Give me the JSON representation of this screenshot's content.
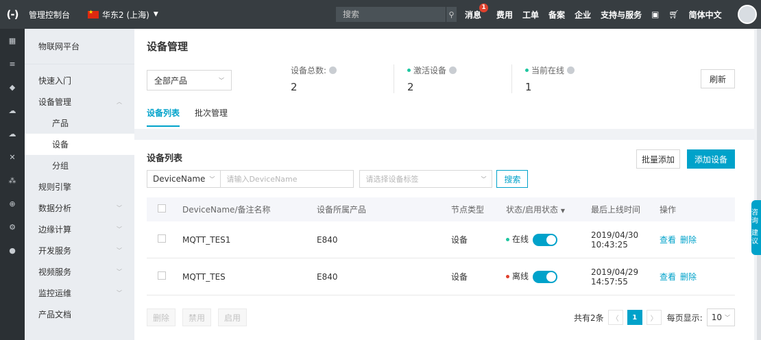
{
  "topbar": {
    "logo": "(-)",
    "console_label": "管理控制台",
    "region": "华东2 (上海)",
    "search_placeholder": "搜索",
    "menu": [
      {
        "label": "消息",
        "badge": "1"
      },
      {
        "label": "费用"
      },
      {
        "label": "工单"
      },
      {
        "label": "备案"
      },
      {
        "label": "企业"
      },
      {
        "label": "支持与服务"
      }
    ],
    "language": "简体中文"
  },
  "sidebar": {
    "title": "物联网平台",
    "items": [
      {
        "label": "快速入门",
        "sub": false
      },
      {
        "label": "设备管理",
        "sub": false
      },
      {
        "label": "产品",
        "sub": true
      },
      {
        "label": "设备",
        "sub": true
      },
      {
        "label": "分组",
        "sub": true
      },
      {
        "label": "规则引擎",
        "sub": false
      },
      {
        "label": "数据分析",
        "sub": false
      },
      {
        "label": "边缘计算",
        "sub": false
      },
      {
        "label": "开发服务",
        "sub": false
      },
      {
        "label": "视频服务",
        "sub": false
      },
      {
        "label": "监控运维",
        "sub": false
      },
      {
        "label": "产品文档",
        "sub": false
      }
    ]
  },
  "header": {
    "title": "设备管理",
    "product_select": "全部产品",
    "stats": [
      {
        "label": "设备总数:",
        "value": "2"
      },
      {
        "label": "激活设备",
        "value": "2"
      },
      {
        "label": "当前在线",
        "value": "1"
      }
    ],
    "refresh": "刷新",
    "tabs": [
      "设备列表",
      "批次管理"
    ]
  },
  "list": {
    "title": "设备列表",
    "batch_add": "批量添加",
    "add_device": "添加设备",
    "filter_field": "DeviceName",
    "filter_placeholder": "请输入DeviceName",
    "tag_placeholder": "请选择设备标签",
    "search_btn": "搜索",
    "columns": [
      "DeviceName/备注名称",
      "设备所属产品",
      "节点类型",
      "状态/启用状态",
      "最后上线时间",
      "操作"
    ],
    "rows": [
      {
        "name": "MQTT_TES1",
        "product": "E840",
        "node": "设备",
        "status": "在线",
        "status_color": "#1ec6a0",
        "date": "2019/04/30",
        "time": "10:43:25",
        "op1": "查看",
        "op2": "删除"
      },
      {
        "name": "MQTT_TES",
        "product": "E840",
        "node": "设备",
        "status": "离线",
        "status_color": "#e0412d",
        "date": "2019/04/29",
        "time": "14:57:55",
        "op1": "查看",
        "op2": "删除"
      }
    ],
    "bottom_buttons": [
      "删除",
      "禁用",
      "启用"
    ],
    "total_text": "共有2条",
    "page": "1",
    "page_size_label": "每页显示:",
    "page_size": "10"
  },
  "float": {
    "text1": "咨询",
    "text2": "建议"
  },
  "colors": {
    "accent": "#00a2ca",
    "topbar": "#373d41",
    "online": "#1ec6a0",
    "offline": "#e0412d"
  }
}
